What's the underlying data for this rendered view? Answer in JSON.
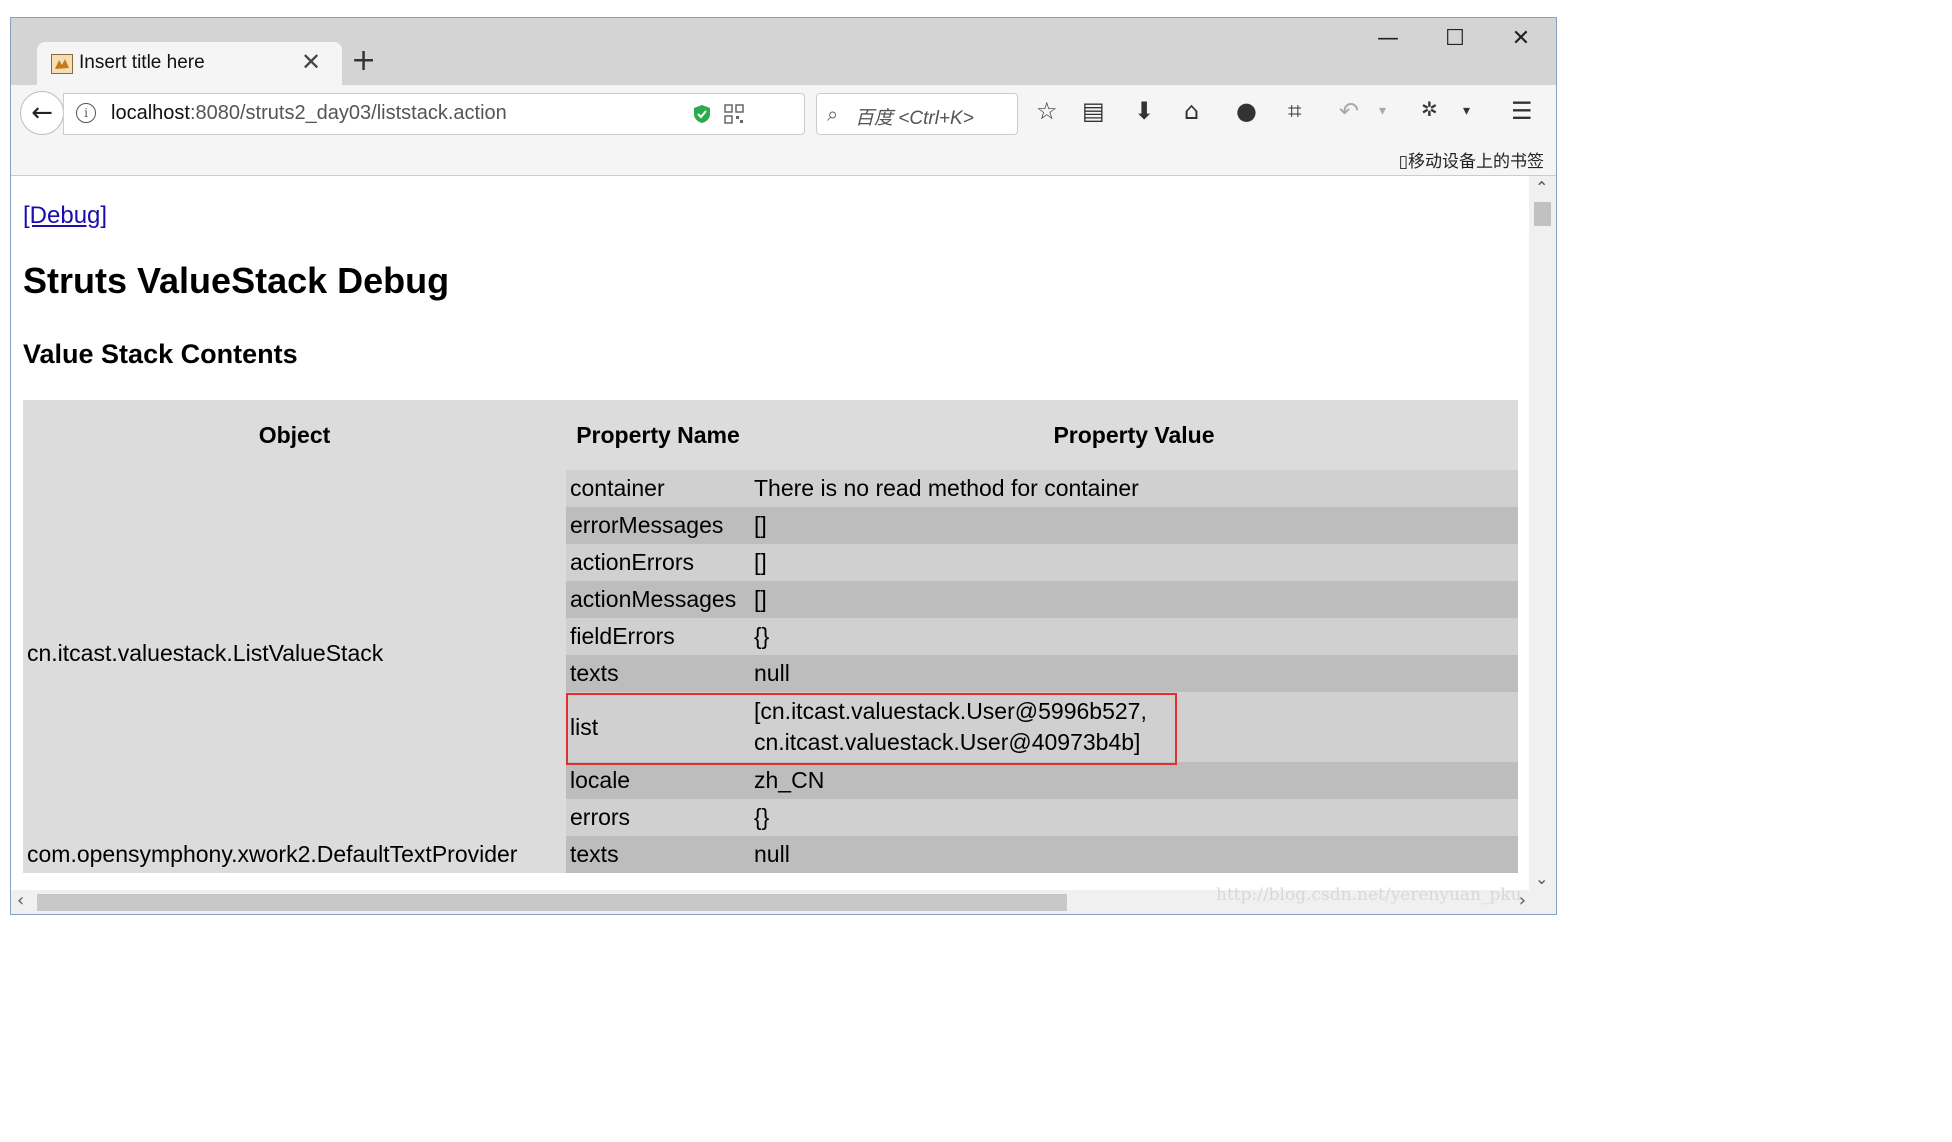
{
  "browser": {
    "tab_title": "Insert title here",
    "tab_close": "✕",
    "new_tab": "+",
    "window_controls": {
      "minimize": "—",
      "maximize": "☐",
      "close": "✕"
    },
    "url_host": "localhost",
    "url_path": ":8080/struts2_day03/liststack.action",
    "search_placeholder": "百度 <Ctrl+K>",
    "mobile_bookmarks": "移动设备上的书签",
    "toolbar_icons": [
      "bookmark-star-icon",
      "reading-list-icon",
      "download-icon",
      "home-icon",
      "chat-icon",
      "crop-icon",
      "undo-icon",
      "extension-icon",
      "menu-icon"
    ]
  },
  "page": {
    "debug_link": "[Debug]",
    "title": "Struts ValueStack Debug",
    "subtitle": "Value Stack Contents",
    "table": {
      "headers": {
        "object": "Object",
        "property_name": "Property Name",
        "property_value": "Property Value"
      },
      "groups": [
        {
          "object": "cn.itcast.valuestack.ListValueStack",
          "rows": [
            {
              "name": "container",
              "value": "There is no read method for container"
            },
            {
              "name": "errorMessages",
              "value": "[]"
            },
            {
              "name": "actionErrors",
              "value": "[]"
            },
            {
              "name": "actionMessages",
              "value": "[]"
            },
            {
              "name": "fieldErrors",
              "value": "{}"
            },
            {
              "name": "texts",
              "value": "null"
            },
            {
              "name": "list",
              "value_line1": "[cn.itcast.valuestack.User@5996b527,",
              "value_line2": "cn.itcast.valuestack.User@40973b4b]"
            },
            {
              "name": "locale",
              "value": "zh_CN"
            },
            {
              "name": "errors",
              "value": "{}"
            }
          ]
        },
        {
          "object": "com.opensymphony.xwork2.DefaultTextProvider",
          "rows": [
            {
              "name": "texts",
              "value": "null"
            }
          ]
        }
      ]
    }
  },
  "watermark": "http://blog.csdn.net/yerenyuan_pku",
  "colors": {
    "highlight": "#e03030",
    "link": "#1a0dab",
    "header_bg": "#dcdcdc"
  }
}
